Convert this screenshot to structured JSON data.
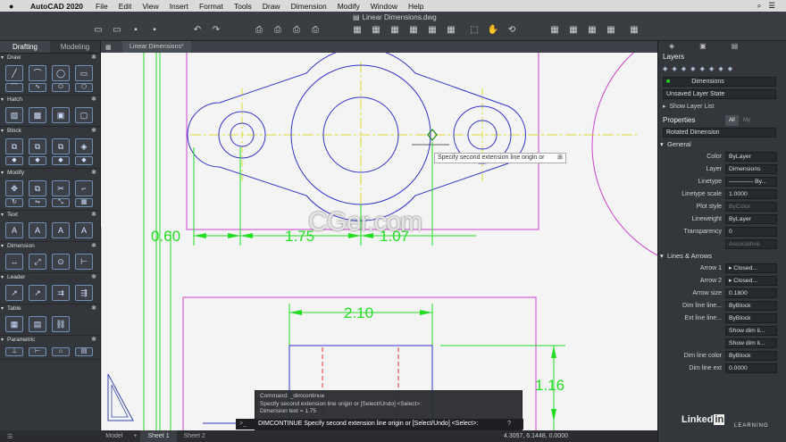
{
  "menubar": {
    "app_name": "AutoCAD 2020",
    "items": [
      "File",
      "Edit",
      "View",
      "Insert",
      "Format",
      "Tools",
      "Draw",
      "Dimension",
      "Modify",
      "Window",
      "Help"
    ]
  },
  "document": {
    "title": "Linear Dimensions.dwg"
  },
  "left_panel": {
    "tabs": [
      "Drafting",
      "Modeling"
    ],
    "sections": [
      "Draw",
      "Hatch",
      "Block",
      "Modify",
      "Text",
      "Dimension",
      "Leader",
      "Table",
      "Parametric"
    ]
  },
  "drawing": {
    "file_tab": "Linear Dimensions*",
    "dims": {
      "d1": "0.60",
      "d2": "1.75",
      "d3": "1.07",
      "d4": "2.10",
      "d5": "1.16"
    },
    "tooltip": "Specify second extension line origin or",
    "watermark": "CGer.com"
  },
  "command": {
    "history": [
      "Command: _dimcontinue",
      "Specify second extension line origin or [Select/Undo] <Select>:",
      "Dimension text = 1.75"
    ],
    "prompt": "DIMCONTINUE Specify second extension line origin or [Select/Undo] <Select>:"
  },
  "status": {
    "tabs": [
      "Model",
      "Sheet 1",
      "Sheet 2"
    ],
    "coords": "4.3057, 6.1448, 0.0000"
  },
  "right_panel": {
    "layers_title": "Layers",
    "layer_name": "Dimensions",
    "layer_state": "Unsaved Layer State",
    "show_layer_list": "Show Layer List",
    "properties_title": "Properties",
    "filter_all": "All",
    "filter_my": "My",
    "object_type": "Rotated Dimension",
    "general_title": "General",
    "general": [
      {
        "label": "Color",
        "value": "ByLayer"
      },
      {
        "label": "Layer",
        "value": "Dimensions"
      },
      {
        "label": "Linetype",
        "value": "———— By..."
      },
      {
        "label": "Linetype scale",
        "value": "1.0000"
      },
      {
        "label": "Plot style",
        "value": "ByColor"
      },
      {
        "label": "Lineweight",
        "value": "ByLayer"
      },
      {
        "label": "Transparency",
        "value": "0"
      },
      {
        "label": "",
        "value": "Associative"
      }
    ],
    "lines_title": "Lines & Arrows",
    "lines": [
      {
        "label": "Arrow 1",
        "value": "▸ Closed..."
      },
      {
        "label": "Arrow 2",
        "value": "▸ Closed..."
      },
      {
        "label": "Arrow size",
        "value": "0.1800"
      },
      {
        "label": "Dim line line...",
        "value": "ByBlock"
      },
      {
        "label": "Ext line line...",
        "value": "ByBlock"
      },
      {
        "label": "",
        "value": "Show dim li..."
      },
      {
        "label": "",
        "value": "Show dim li..."
      },
      {
        "label": "Dim line color",
        "value": "ByBlock"
      },
      {
        "label": "Dim line ext",
        "value": "0.0000"
      }
    ],
    "brand": "Linked",
    "brand_in": "in",
    "brand_sub": "LEARNING"
  },
  "colors": {
    "accent_green": "#22dd22",
    "magenta": "#cc44cc",
    "blue": "#3333cc",
    "bg": "#f4f4f4"
  }
}
